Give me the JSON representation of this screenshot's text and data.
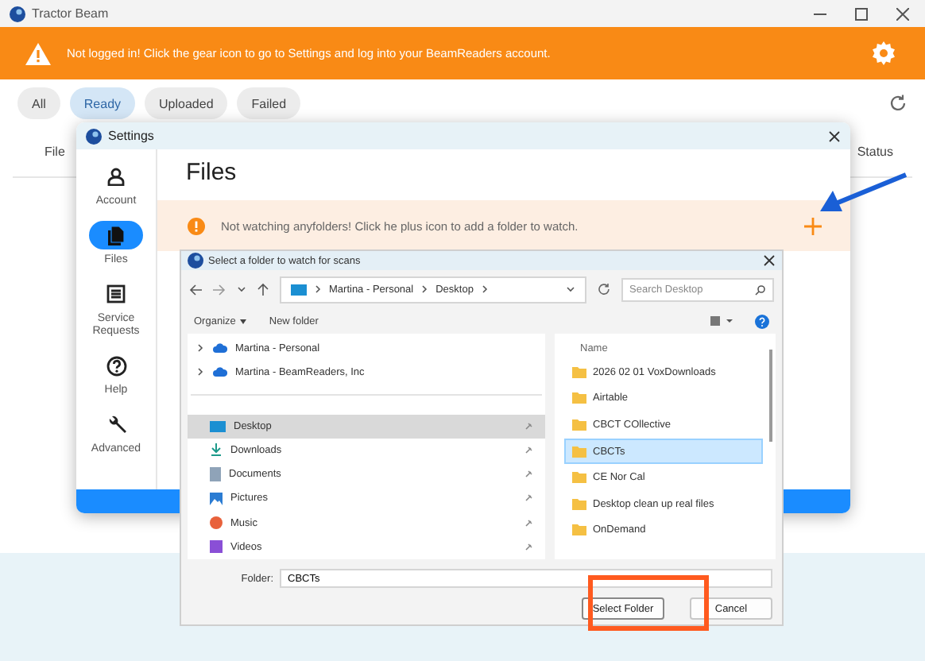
{
  "app_window": {
    "title": "Tractor Beam"
  },
  "banner": {
    "message": "Not logged in! Click the gear icon to go to Settings and log into your BeamReaders account."
  },
  "filters": [
    {
      "label": "All",
      "selected": false
    },
    {
      "label": "Ready",
      "selected": true
    },
    {
      "label": "Uploaded",
      "selected": false
    },
    {
      "label": "Failed",
      "selected": false
    }
  ],
  "table": {
    "columns": [
      "File",
      "Status"
    ]
  },
  "settings": {
    "title": "Settings",
    "nav": [
      {
        "label": "Account",
        "kind": "account",
        "selected": false
      },
      {
        "label": "Files",
        "kind": "files",
        "selected": true
      },
      {
        "label": "Service Requests",
        "kind": "list",
        "selected": false
      },
      {
        "label": "Help",
        "kind": "help",
        "selected": false
      },
      {
        "label": "Advanced",
        "kind": "wrench",
        "selected": false
      }
    ],
    "heading": "Files",
    "notice": "Not watching anyfolders! Click he plus icon to add a folder to watch."
  },
  "folder_dialog": {
    "title": "Select a folder to watch for scans",
    "breadcrumb": [
      "Martina - Personal",
      "Desktop"
    ],
    "search": {
      "placeholder": "Search Desktop"
    },
    "toolbar": [
      "Organize",
      "New folder"
    ],
    "tree": [
      {
        "label": "Martina - Personal",
        "kind": "cloud"
      },
      {
        "label": "Martina - BeamReaders, Inc",
        "kind": "cloud"
      }
    ],
    "quick_access": [
      {
        "label": "Desktop",
        "kind": "desktop",
        "selected": true
      },
      {
        "label": "Downloads",
        "kind": "download",
        "selected": false
      },
      {
        "label": "Documents",
        "kind": "document",
        "selected": false
      },
      {
        "label": "Pictures",
        "kind": "pictures",
        "selected": false
      },
      {
        "label": "Music",
        "kind": "music",
        "selected": false
      },
      {
        "label": "Videos",
        "kind": "video",
        "selected": false
      }
    ],
    "column_header": "Name",
    "folders": [
      {
        "name": "2026 02 01 VoxDownloads",
        "selected": false
      },
      {
        "name": "Airtable",
        "selected": false
      },
      {
        "name": "CBCT COllective",
        "selected": false
      },
      {
        "name": "CBCTs",
        "selected": true
      },
      {
        "name": "CE Nor Cal",
        "selected": false
      },
      {
        "name": "Desktop clean up real files",
        "selected": false
      },
      {
        "name": "OnDemand",
        "selected": false
      }
    ],
    "folder_label": "Folder:",
    "folder_value": "CBCTs",
    "buttons": [
      "Select Folder",
      "Cancel"
    ]
  }
}
